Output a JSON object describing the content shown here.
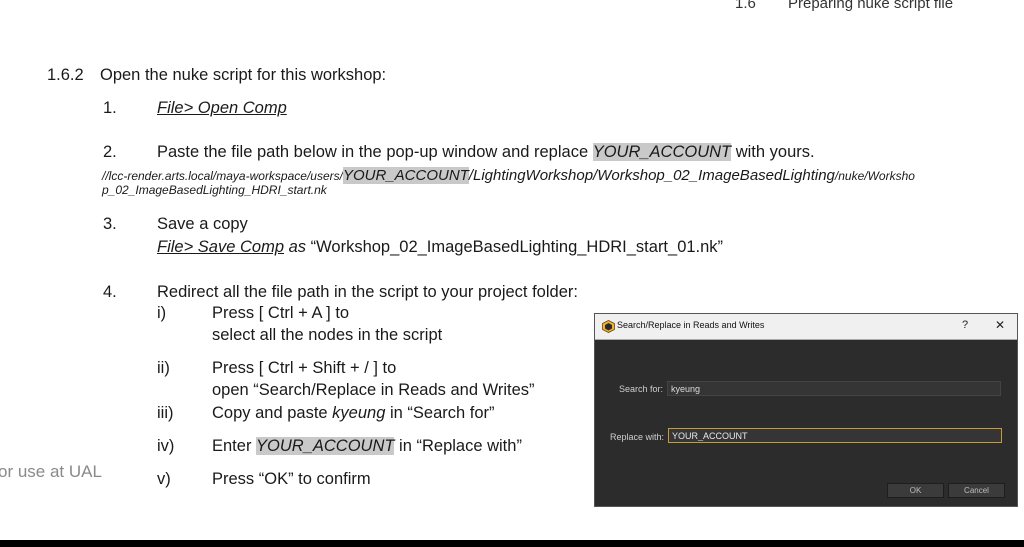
{
  "header": {
    "number": "1.6",
    "title": "Preparing nuke script file"
  },
  "section": {
    "number": "1.6.2",
    "title": "Open the nuke script for this workshop:"
  },
  "step1": {
    "num": "1.",
    "link": "File> Open Comp"
  },
  "step2": {
    "num": "2.",
    "pre": "Paste the file path below in the pop-up window and replace ",
    "highlight": "YOUR_ACCOUNT",
    "post": " with yours.",
    "path_pre": "//lcc-render.arts.local/maya-workspace/users/",
    "path_highlight": "YOUR_ACCOUNT",
    "path_mid": "/LightingWorkshop/Workshop_02_ImageBasedLighting",
    "path_tail": "/nuke/Worksho",
    "path_line2": "p_02_ImageBasedLighting_HDRI_start.nk"
  },
  "step3": {
    "num": "3.",
    "line1": "Save a copy",
    "link": "File> Save Comp",
    "as": " as ",
    "filename": "“Workshop_02_ImageBasedLighting_HDRI_start_01.nk”"
  },
  "step4": {
    "num": "4.",
    "line1": "Redirect all the file path in the script to your project folder:",
    "subs": [
      {
        "num": "i)",
        "line1": "Press [ Ctrl + A ] to",
        "line2": "select all the nodes in the script"
      },
      {
        "num": "ii)",
        "line1": "Press [ Ctrl + Shift + / ] to",
        "line2": "open “Search/Replace in Reads and Writes”"
      },
      {
        "num": "iii)",
        "pre": "Copy and paste ",
        "italic": "kyeung",
        "post": " in “Search for”"
      },
      {
        "num": "iv)",
        "pre": "Enter ",
        "highlight": "YOUR_ACCOUNT",
        "post": "  in “Replace with”"
      },
      {
        "num": "v)",
        "text": "Press “OK” to confirm"
      }
    ]
  },
  "watermark": "or use at UAL",
  "dialog": {
    "title": "Search/Replace in Reads and Writes",
    "help": "?",
    "close": "✕",
    "search_label": "Search for:",
    "search_value": "kyeung",
    "replace_label": "Replace with:",
    "replace_value": "YOUR_ACCOUNT",
    "ok": "OK",
    "cancel": "Cancel"
  },
  "colors": {
    "highlight": "#c9c9c9",
    "dialog_bg": "#2c2c2c",
    "focus_border": "#c89a3a"
  }
}
